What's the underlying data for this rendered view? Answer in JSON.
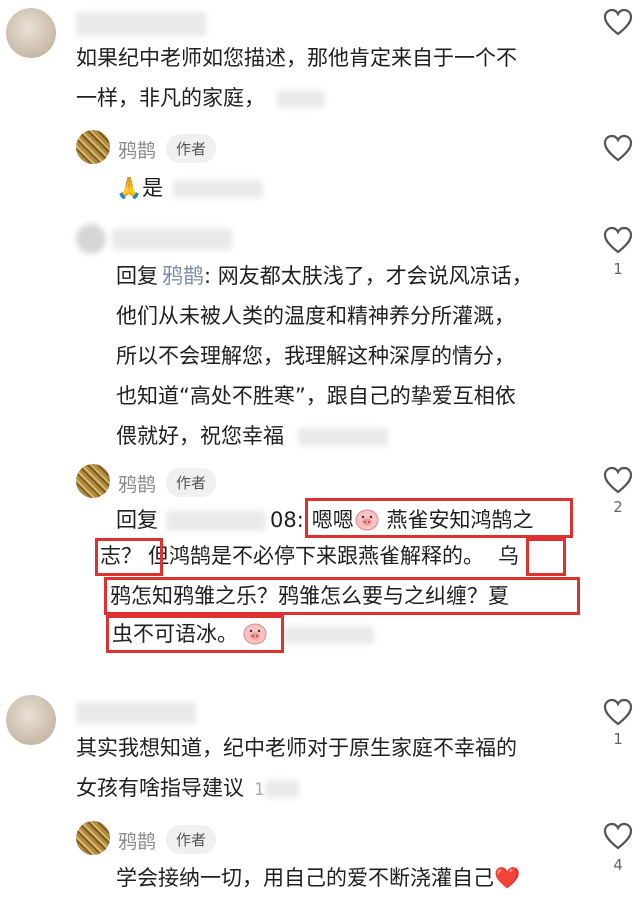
{
  "comments": [
    {
      "text_line1": "如果纪中老师如您描述，那他肯定来自于一个不",
      "text_line2": "一样，非凡的家庭，",
      "likes": ""
    },
    {
      "author": "鸦鹊",
      "tag": "作者",
      "text": "🙏是",
      "likes": ""
    },
    {
      "reply_label": "回复",
      "reply_to": "鸦鹊",
      "lines": [
        ": 网友都太肤浅了，才会说风凉话，",
        "他们从未被人类的温度和精神养分所灌溉，",
        "所以不会理解您，我理解这种深厚的情分，",
        "也知道“高处不胜寒”，跟自己的挚爱互相依",
        "偎就好，祝您幸福"
      ],
      "likes": "1"
    },
    {
      "author": "鸦鹊",
      "tag": "作者",
      "reply_label": "回复",
      "reply_suffix": "08:",
      "seg1a": "嗯嗯",
      "seg1b": " 燕雀安知鸿鹄之",
      "seg2": "志？",
      "seg3": "但鸿鹄是不必停下来跟燕雀解释的。",
      "seg4": "乌",
      "seg5": "鸦怎知鸦雏之乐？鸦雏怎么要与之纠缠？夏",
      "seg6": "虫不可语冰。",
      "likes": "2"
    },
    {
      "text_line1": "其实我想知道，纪中老师对于原生家庭不幸福的",
      "text_line2": "女孩有啥指导建议",
      "time": "1",
      "likes": "1"
    },
    {
      "author": "鸦鹊",
      "tag": "作者",
      "text": "学会接纳一切，用自己的爱不断浇灌自己❤️",
      "likes": "4"
    }
  ],
  "colors": {
    "highlight": "#e03131",
    "name": "#8b8b8b",
    "link": "#7a8fa6"
  }
}
